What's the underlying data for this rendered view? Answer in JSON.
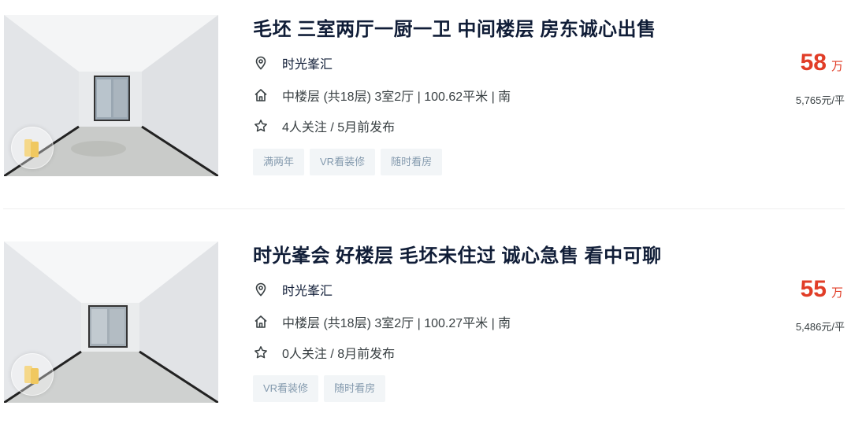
{
  "colors": {
    "title": "#101d37",
    "price": "#e13d27",
    "tag_bg": "#f2f5f7",
    "tag_text": "#849aae"
  },
  "listings": [
    {
      "title": "毛坯 三室两厅一厨一卫 中间楼层 房东诚心出售",
      "community": "时光峯汇",
      "info": "中楼层 (共18层) 3室2厅 | 100.62平米 | 南",
      "follow": "4人关注 / 5月前发布",
      "tags": [
        "满两年",
        "VR看装修",
        "随时看房"
      ],
      "price": "58",
      "price_unit": "万",
      "unit_price": "5,765元/平",
      "icons": [
        "location-pin-icon",
        "house-icon",
        "star-icon",
        "vr-icon"
      ]
    },
    {
      "title": "时光峯会 好楼层 毛坯未住过 诚心急售 看中可聊",
      "community": "时光峯汇",
      "info": "中楼层 (共18层) 3室2厅 | 100.27平米 | 南",
      "follow": "0人关注 / 8月前发布",
      "tags": [
        "VR看装修",
        "随时看房"
      ],
      "price": "55",
      "price_unit": "万",
      "unit_price": "5,486元/平",
      "icons": [
        "location-pin-icon",
        "house-icon",
        "star-icon",
        "vr-icon"
      ]
    }
  ]
}
